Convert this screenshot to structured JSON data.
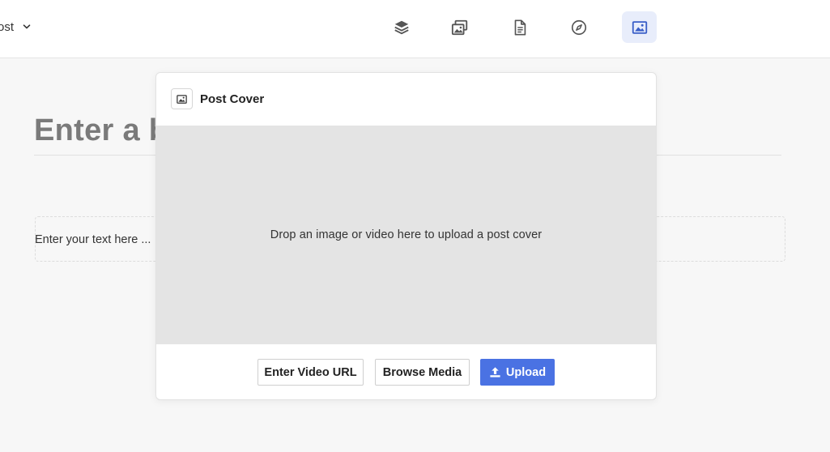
{
  "header": {
    "post_type_label": "ost",
    "toolbar": [
      {
        "icon": "layers-icon",
        "active": false
      },
      {
        "icon": "media-gallery-icon",
        "active": false
      },
      {
        "icon": "document-icon",
        "active": false
      },
      {
        "icon": "compass-icon",
        "active": false
      },
      {
        "icon": "image-icon",
        "active": true
      }
    ]
  },
  "editor": {
    "title_placeholder": "Enter a b",
    "text_placeholder": "Enter your text here ..."
  },
  "modal": {
    "title": "Post Cover",
    "dropzone_text": "Drop an image or video here to upload a post cover",
    "buttons": {
      "video_url": "Enter Video URL",
      "browse": "Browse Media",
      "upload": "Upload"
    }
  },
  "colors": {
    "accent": "#4a72e3",
    "active_bg": "#e8edfb",
    "dropzone_bg": "#e4e4e4"
  }
}
